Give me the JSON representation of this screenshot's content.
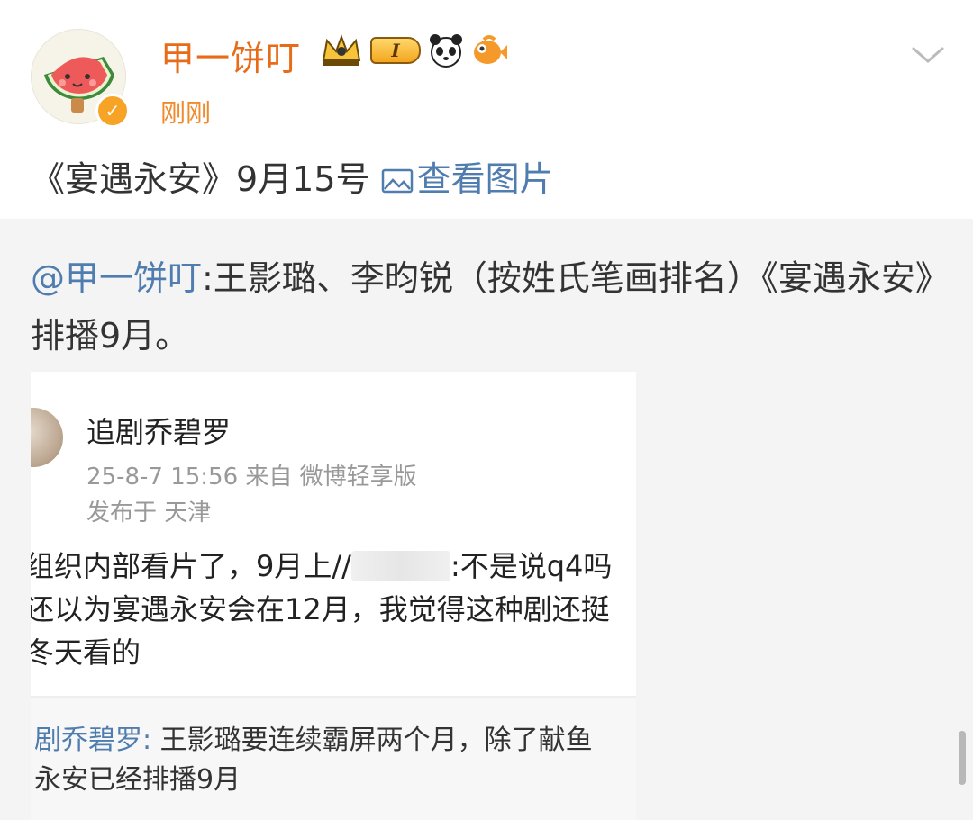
{
  "post": {
    "username": "甲一饼叮",
    "level_badge": "I",
    "timestamp": "刚刚",
    "text": "《宴遇永安》9月15号",
    "view_pictures_label": "查看图片"
  },
  "repost": {
    "mention": "@甲一饼叮",
    "text": ":王影璐、李昀锐（按姓氏笔画排名）《宴遇永安》排播9月。"
  },
  "screenshot": {
    "name": "追剧乔碧罗",
    "meta": "25-8-7 15:56  来自 微博轻享版",
    "location": "发布于 天津",
    "body_line1_a": "组织内部看片了，9月上//",
    "body_line1_b": ":不是说q4吗",
    "body_line2": "还以为宴遇永安会在12月，我觉得这种剧还挺",
    "body_line3": "冬天看的",
    "comment_name": "剧乔碧罗:",
    "comment_line1": " 王影璐要连续霸屏两个月，除了献鱼",
    "comment_line2": "永安已经排播9月"
  },
  "colors": {
    "username": "#e86b18",
    "timestamp": "#f08a2b",
    "link": "#507daf",
    "repost_bg": "#f4f4f4"
  },
  "icons": [
    "crown-badge-icon",
    "panda-icon",
    "fish-icon",
    "chevron-down-icon",
    "image-icon",
    "verified-icon"
  ]
}
